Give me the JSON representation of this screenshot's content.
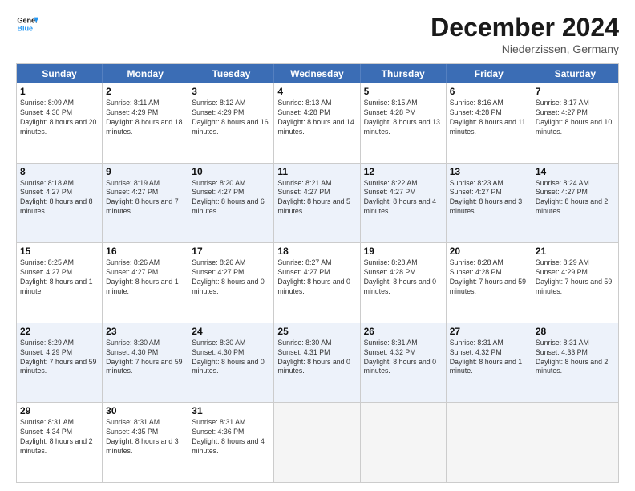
{
  "logo": {
    "text_general": "General",
    "text_blue": "Blue"
  },
  "title": "December 2024",
  "location": "Niederzissen, Germany",
  "days_of_week": [
    "Sunday",
    "Monday",
    "Tuesday",
    "Wednesday",
    "Thursday",
    "Friday",
    "Saturday"
  ],
  "weeks": [
    [
      {
        "day": "1",
        "sunrise": "8:09 AM",
        "sunset": "4:30 PM",
        "daylight": "8 hours and 20 minutes.",
        "empty": false
      },
      {
        "day": "2",
        "sunrise": "8:11 AM",
        "sunset": "4:29 PM",
        "daylight": "8 hours and 18 minutes.",
        "empty": false
      },
      {
        "day": "3",
        "sunrise": "8:12 AM",
        "sunset": "4:29 PM",
        "daylight": "8 hours and 16 minutes.",
        "empty": false
      },
      {
        "day": "4",
        "sunrise": "8:13 AM",
        "sunset": "4:28 PM",
        "daylight": "8 hours and 14 minutes.",
        "empty": false
      },
      {
        "day": "5",
        "sunrise": "8:15 AM",
        "sunset": "4:28 PM",
        "daylight": "8 hours and 13 minutes.",
        "empty": false
      },
      {
        "day": "6",
        "sunrise": "8:16 AM",
        "sunset": "4:28 PM",
        "daylight": "8 hours and 11 minutes.",
        "empty": false
      },
      {
        "day": "7",
        "sunrise": "8:17 AM",
        "sunset": "4:27 PM",
        "daylight": "8 hours and 10 minutes.",
        "empty": false
      }
    ],
    [
      {
        "day": "8",
        "sunrise": "8:18 AM",
        "sunset": "4:27 PM",
        "daylight": "8 hours and 8 minutes.",
        "empty": false
      },
      {
        "day": "9",
        "sunrise": "8:19 AM",
        "sunset": "4:27 PM",
        "daylight": "8 hours and 7 minutes.",
        "empty": false
      },
      {
        "day": "10",
        "sunrise": "8:20 AM",
        "sunset": "4:27 PM",
        "daylight": "8 hours and 6 minutes.",
        "empty": false
      },
      {
        "day": "11",
        "sunrise": "8:21 AM",
        "sunset": "4:27 PM",
        "daylight": "8 hours and 5 minutes.",
        "empty": false
      },
      {
        "day": "12",
        "sunrise": "8:22 AM",
        "sunset": "4:27 PM",
        "daylight": "8 hours and 4 minutes.",
        "empty": false
      },
      {
        "day": "13",
        "sunrise": "8:23 AM",
        "sunset": "4:27 PM",
        "daylight": "8 hours and 3 minutes.",
        "empty": false
      },
      {
        "day": "14",
        "sunrise": "8:24 AM",
        "sunset": "4:27 PM",
        "daylight": "8 hours and 2 minutes.",
        "empty": false
      }
    ],
    [
      {
        "day": "15",
        "sunrise": "8:25 AM",
        "sunset": "4:27 PM",
        "daylight": "8 hours and 1 minute.",
        "empty": false
      },
      {
        "day": "16",
        "sunrise": "8:26 AM",
        "sunset": "4:27 PM",
        "daylight": "8 hours and 1 minute.",
        "empty": false
      },
      {
        "day": "17",
        "sunrise": "8:26 AM",
        "sunset": "4:27 PM",
        "daylight": "8 hours and 0 minutes.",
        "empty": false
      },
      {
        "day": "18",
        "sunrise": "8:27 AM",
        "sunset": "4:27 PM",
        "daylight": "8 hours and 0 minutes.",
        "empty": false
      },
      {
        "day": "19",
        "sunrise": "8:28 AM",
        "sunset": "4:28 PM",
        "daylight": "8 hours and 0 minutes.",
        "empty": false
      },
      {
        "day": "20",
        "sunrise": "8:28 AM",
        "sunset": "4:28 PM",
        "daylight": "7 hours and 59 minutes.",
        "empty": false
      },
      {
        "day": "21",
        "sunrise": "8:29 AM",
        "sunset": "4:29 PM",
        "daylight": "7 hours and 59 minutes.",
        "empty": false
      }
    ],
    [
      {
        "day": "22",
        "sunrise": "8:29 AM",
        "sunset": "4:29 PM",
        "daylight": "7 hours and 59 minutes.",
        "empty": false
      },
      {
        "day": "23",
        "sunrise": "8:30 AM",
        "sunset": "4:30 PM",
        "daylight": "7 hours and 59 minutes.",
        "empty": false
      },
      {
        "day": "24",
        "sunrise": "8:30 AM",
        "sunset": "4:30 PM",
        "daylight": "8 hours and 0 minutes.",
        "empty": false
      },
      {
        "day": "25",
        "sunrise": "8:30 AM",
        "sunset": "4:31 PM",
        "daylight": "8 hours and 0 minutes.",
        "empty": false
      },
      {
        "day": "26",
        "sunrise": "8:31 AM",
        "sunset": "4:32 PM",
        "daylight": "8 hours and 0 minutes.",
        "empty": false
      },
      {
        "day": "27",
        "sunrise": "8:31 AM",
        "sunset": "4:32 PM",
        "daylight": "8 hours and 1 minute.",
        "empty": false
      },
      {
        "day": "28",
        "sunrise": "8:31 AM",
        "sunset": "4:33 PM",
        "daylight": "8 hours and 2 minutes.",
        "empty": false
      }
    ],
    [
      {
        "day": "29",
        "sunrise": "8:31 AM",
        "sunset": "4:34 PM",
        "daylight": "8 hours and 2 minutes.",
        "empty": false
      },
      {
        "day": "30",
        "sunrise": "8:31 AM",
        "sunset": "4:35 PM",
        "daylight": "8 hours and 3 minutes.",
        "empty": false
      },
      {
        "day": "31",
        "sunrise": "8:31 AM",
        "sunset": "4:36 PM",
        "daylight": "8 hours and 4 minutes.",
        "empty": false
      },
      {
        "day": "",
        "sunrise": "",
        "sunset": "",
        "daylight": "",
        "empty": true
      },
      {
        "day": "",
        "sunrise": "",
        "sunset": "",
        "daylight": "",
        "empty": true
      },
      {
        "day": "",
        "sunrise": "",
        "sunset": "",
        "daylight": "",
        "empty": true
      },
      {
        "day": "",
        "sunrise": "",
        "sunset": "",
        "daylight": "",
        "empty": true
      }
    ]
  ],
  "alt_rows": [
    1,
    3
  ]
}
